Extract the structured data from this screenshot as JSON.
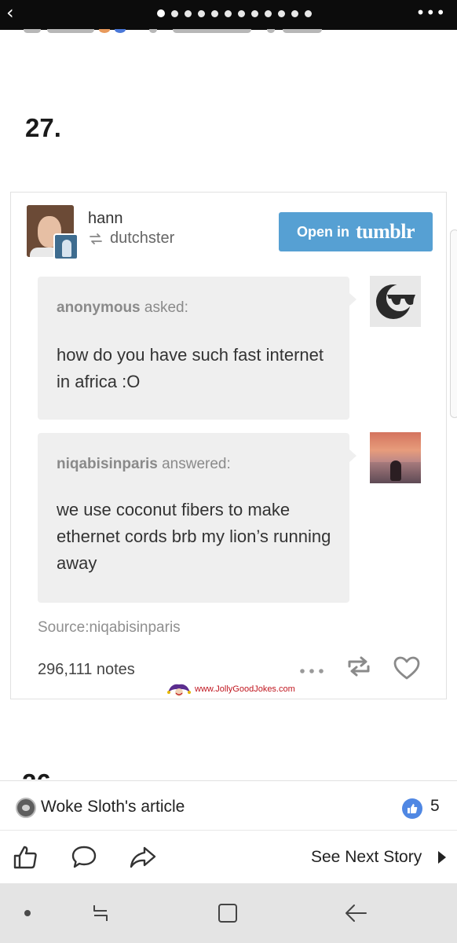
{
  "post": {
    "number": "27.",
    "blog_name": "hann",
    "reblogged_from": "dutchster",
    "open_button": {
      "prefix": "Open in",
      "brand": "tumblr"
    },
    "question": {
      "asker": "anonymous",
      "verb": "asked:",
      "text": "how do you have such fast internet in africa :O"
    },
    "answer": {
      "answerer": "niqabisinparis",
      "verb": "answered:",
      "text": "we use coconut fibers to make ethernet cords brb my lion’s running away"
    },
    "source": "Source:niqabisinparis",
    "notes": "296,111 notes"
  },
  "watermark": "www.JollyGoodJokes.com",
  "article_bar": {
    "title": "Woke Sloth's article",
    "like_count": "5"
  },
  "action_bar": {
    "next_story": "See Next Story"
  },
  "icons": {
    "back": "chevron-left-icon",
    "overflow": "more-horizontal-icon",
    "reblog": "reblog-icon",
    "like": "heart-icon",
    "thumbs_up": "thumbs-up-icon",
    "comment": "comment-icon",
    "share": "share-icon"
  },
  "colors": {
    "tumblr_blue": "#56a0d3",
    "facebook_like": "#4f87e3",
    "nav_bar": "#e4e4e4"
  }
}
